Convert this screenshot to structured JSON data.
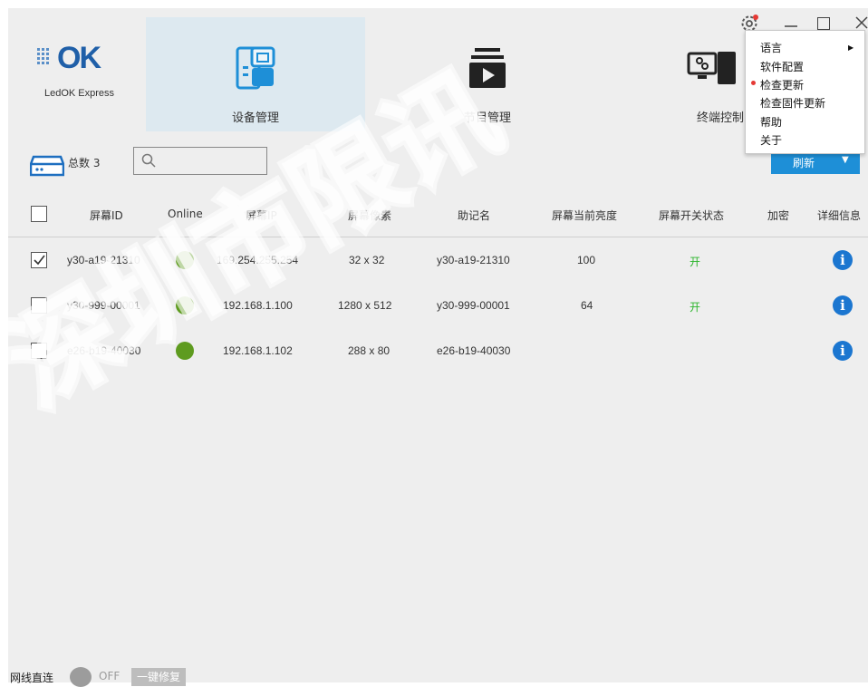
{
  "app": {
    "logo_mark": "OK",
    "logo_text": "LedOK Express"
  },
  "tabs": [
    {
      "label": "设备管理",
      "icon": "device-icon",
      "active": true
    },
    {
      "label": "节目管理",
      "icon": "program-icon",
      "active": false
    },
    {
      "label": "终端控制",
      "icon": "terminal-control-icon",
      "active": false
    }
  ],
  "toolbar": {
    "count_label": "总数 3",
    "search_placeholder": "",
    "refresh_label": "刷新"
  },
  "table": {
    "columns": [
      "屏幕ID",
      "Online",
      "屏幕IP",
      "屏幕像素",
      "助记名",
      "屏幕当前亮度",
      "屏幕开关状态",
      "加密",
      "详细信息"
    ],
    "rows": [
      {
        "checked": true,
        "id": "y30-a19-21310",
        "online": true,
        "ip": "169.254.255.254",
        "pixels": "32 x 32",
        "alias": "y30-a19-21310",
        "brightness": "100",
        "power": "开"
      },
      {
        "checked": false,
        "id": "y30-999-00001",
        "online": true,
        "ip": "192.168.1.100",
        "pixels": "1280 x 512",
        "alias": "y30-999-00001",
        "brightness": "64",
        "power": "开"
      },
      {
        "checked": false,
        "id": "e26-b19-40030",
        "online": true,
        "ip": "192.168.1.102",
        "pixels": "288 x 80",
        "alias": "e26-b19-40030",
        "brightness": "",
        "power": ""
      }
    ]
  },
  "statusbar": {
    "net_label": "网线直连",
    "toggle_state": "OFF",
    "repair_label": "一键修复"
  },
  "menu": {
    "items": [
      "语言",
      "软件配置",
      "检查更新",
      "检查固件更新",
      "帮助",
      "关于"
    ]
  },
  "watermark": {
    "text": "深圳市限讯"
  },
  "colors": {
    "accent": "#1e8fd7",
    "online": "#5e9b1f",
    "power_on": "#2db52d",
    "info": "#1b76d0",
    "badge": "#e53935"
  }
}
